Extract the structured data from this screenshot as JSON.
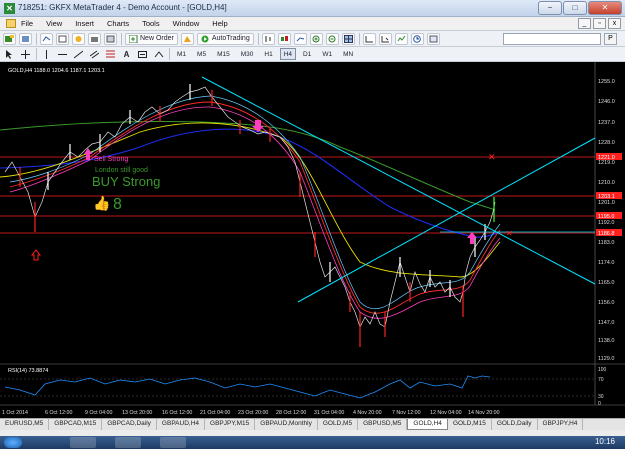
{
  "window": {
    "title": "718251: GKFX MetaTrader 4 - Demo Account - [GOLD,H4]",
    "icon": "metatrader-icon",
    "minimize": "−",
    "maximize": "□",
    "close": "✕"
  },
  "menu": {
    "items": [
      "File",
      "View",
      "Insert",
      "Charts",
      "Tools",
      "Window",
      "Help"
    ],
    "mdi_minimize": "_",
    "mdi_restore": "▫",
    "mdi_close": "x"
  },
  "toolbar": {
    "new_order_label": "New Order",
    "autotrading_label": "AutoTrading",
    "timeframes": [
      "M1",
      "M5",
      "M15",
      "M30",
      "H1",
      "H4",
      "D1",
      "W1",
      "MN"
    ],
    "active_timeframe": "H4",
    "search_icon": "search-icon",
    "search_button": "P"
  },
  "chart": {
    "header": "GOLD,H4  1188.0 1204.6 1187.1 1203.1",
    "price_labels": [
      "1255.0",
      "1246.0",
      "1237.0",
      "1228.0",
      "1219.0",
      "1210.0",
      "1201.0",
      "1192.0",
      "1183.0",
      "1174.0",
      "1165.0",
      "1156.0",
      "1147.0",
      "1138.0",
      "1129.0"
    ],
    "highlighted_prices": [
      "1221.0",
      "1203.1",
      "1195.0",
      "1186.8"
    ],
    "texts": {
      "annotation1": "Sell Strong",
      "annotation2": "London still good",
      "annotation3": "BUY Strong"
    },
    "rsi": {
      "header": "RSI(14) 73.8874",
      "levels": [
        "100",
        "70",
        "30",
        "0"
      ]
    },
    "time_labels": [
      "1 Oct 2014",
      "6 Oct 12:00",
      "9 Oct 04:00",
      "13 Oct 20:00",
      "16 Oct 12:00",
      "21 Oct 04:00",
      "23 Oct 20:00",
      "28 Oct 12:00",
      "31 Oct 04:00",
      "4 Nov 20:00",
      "7 Nov 12:00",
      "12 Nov 04:00",
      "14 Nov 20:00"
    ],
    "colors": {
      "up_candle": "#ffffff",
      "down_candle": "#ff0000",
      "trendline": "#00e5ff",
      "ma_blue": "#1d2cf0",
      "ma_yellow": "#e8e000",
      "ma_green": "#3a9a2a",
      "horizontal_line": "#ff2020"
    }
  },
  "tabs": [
    "EURUSD,M5",
    "GBPCAD,M15",
    "GBPCAD,Daily",
    "GBPAUD,H4",
    "GBPJPY,M15",
    "GBPAUD,Monthly",
    "GOLD,M5",
    "GBPUSD,M5",
    "GOLD,H4",
    "GOLD,M15",
    "GOLD,Daily",
    "GBPJPY,H4"
  ],
  "active_tab": "GOLD,H4",
  "taskbar": {
    "clock": "10:16"
  }
}
